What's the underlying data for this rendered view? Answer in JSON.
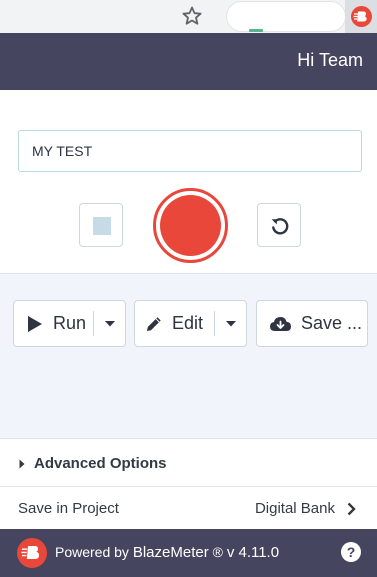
{
  "browser": {
    "star_icon": "star-outline-icon",
    "extension_icon": "blazemeter-logo-icon"
  },
  "header": {
    "greeting": "Hi Team"
  },
  "test": {
    "name_value": "MY TEST"
  },
  "recorder": {
    "stop_icon": "stop-square-icon",
    "record_icon": "record-circle-icon",
    "reset_icon": "reset-arrow-icon",
    "record_color": "#e8473a"
  },
  "actions": {
    "run_label": "Run",
    "edit_label": "Edit",
    "save_label": "Save ..."
  },
  "advanced": {
    "label": "Advanced Options"
  },
  "project": {
    "label": "Save in Project",
    "value": "Digital Bank"
  },
  "footer": {
    "powered_by": "Powered by",
    "brand": "BlazeMeter",
    "registered": "®",
    "version": "v 4.11.0",
    "help": "?"
  },
  "colors": {
    "header_bg": "#45455f",
    "accent_red": "#e8473a",
    "panel_bg": "#f1f4fb"
  }
}
